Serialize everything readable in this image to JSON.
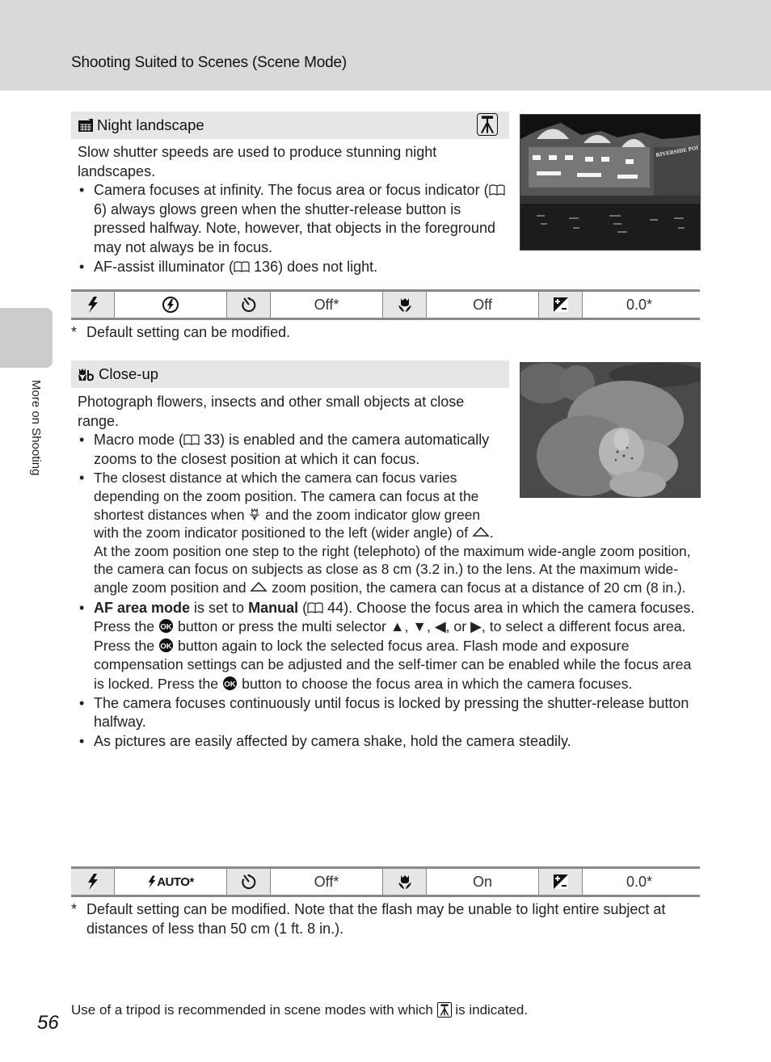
{
  "header": {
    "title": "Shooting Suited to Scenes (Scene Mode)"
  },
  "side_tab": {
    "label": "More on Shooting"
  },
  "sections": [
    {
      "title": "Night landscape",
      "icon": "night-landscape-icon",
      "tripod_indicator": "tripod-icon",
      "intro": "Slow shutter speeds are used to produce stunning night landscapes.",
      "bullets": [
        {
          "pre": "Camera focuses at infinity. The focus area or focus indicator (",
          "ref": "6",
          "post": ") always glows green when the shutter-release button is pressed halfway. Note, however, that objects in the foreground may not always be in focus."
        },
        {
          "pre": "AF-assist illuminator (",
          "ref": "136",
          "post": ") does not light."
        }
      ],
      "photo_alt": "Night riverside buildings (Riverside Point)",
      "photo_sign": "RIVERSIDE POI",
      "settings": {
        "flash_icon": "flash-icon",
        "flash_value_icon": "flash-off-icon",
        "flash_value": "",
        "self_timer_icon": "self-timer-icon",
        "self_timer_value": "Off*",
        "macro_icon": "macro-icon",
        "macro_value": "Off",
        "exposure_icon": "exposure-compensation-icon",
        "exposure_value": "0.0*"
      },
      "footnote": {
        "mark": "*",
        "text": "Default setting can be modified."
      }
    },
    {
      "title": "Close-up",
      "icon": "close-up-icon",
      "intro": "Photograph flowers, insects and other small objects at close range.",
      "bullet1": {
        "pre": "Macro mode (",
        "ref": "33",
        "post": ") is enabled and the camera automatically zooms to the closest position at which it can focus."
      },
      "bullet2": {
        "line_a": "The closest distance at which the camera can focus varies depending on the zoom position. The camera can focus at the shortest distances when ",
        "line_b": " and the zoom indicator glow green with the zoom indicator positioned to the left (wider angle) of ",
        "line_c": ".",
        "para2_a": "At the zoom position one step to the right (telephoto) of the maximum wide-angle zoom position, the camera can focus on subjects as close as 8 cm (3.2 in.) to the lens. At the maximum wide-angle zoom position and ",
        "para2_b": " zoom position, the camera can focus at a distance of 20 cm (8 in.)."
      },
      "bullet3": {
        "bold1": "AF area mode",
        "mid1": " is set to ",
        "bold2": "Manual",
        "pre_ref": " (",
        "ref": "44",
        "post": "). Choose the focus area in which the camera focuses.",
        "p2_a": "Press the ",
        "p2_b": " button or press the multi selector ▲, ▼, ◀, or ▶, to select a different focus area. Press the ",
        "p2_c": " button again to lock the selected focus area. Flash mode and exposure compensation settings can be adjusted and the self-timer can be enabled while the focus area is locked. Press the ",
        "p2_d": " button to choose the focus area in which the camera focuses."
      },
      "bullet4": "The camera focuses continuously until focus is locked by pressing the shutter-release button halfway.",
      "bullet5": "As pictures are easily affected by camera shake, hold the camera steadily.",
      "photo_alt": "Close-up of an orchid flower",
      "settings": {
        "flash_icon": "flash-icon",
        "flash_value": "AUTO*",
        "self_timer_icon": "self-timer-icon",
        "self_timer_value": "Off*",
        "macro_icon": "macro-icon",
        "macro_value": "On",
        "exposure_icon": "exposure-compensation-icon",
        "exposure_value": "0.0*"
      },
      "footnote": {
        "mark": "*",
        "text": "Default setting can be modified. Note that the flash may be unable to light entire subject at distances of less than 50 cm (1 ft. 8 in.)."
      }
    }
  ],
  "footer": {
    "page_number": "56",
    "note_pre": "Use of a tripod is recommended in scene modes with which ",
    "note_post": " is indicated."
  }
}
